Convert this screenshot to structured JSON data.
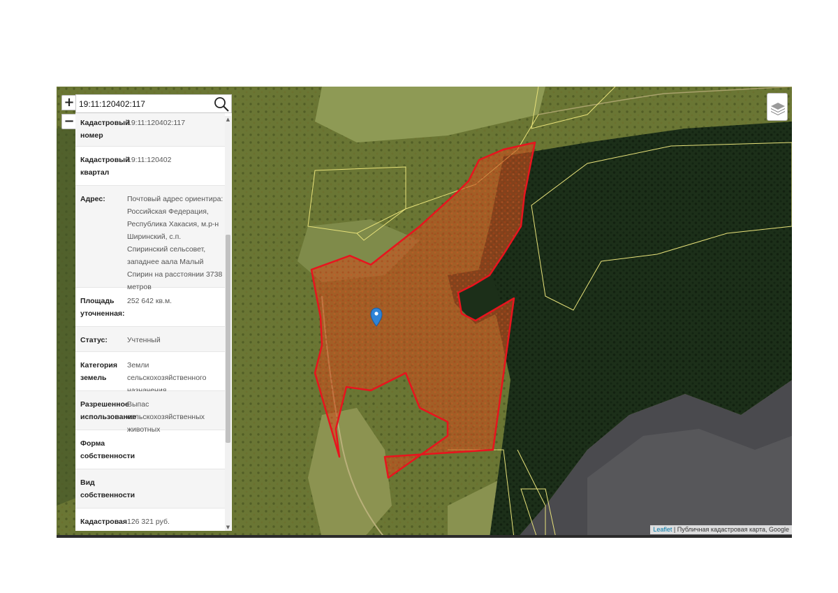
{
  "search": {
    "value": "19:11:120402:117"
  },
  "zoom": {
    "in_label": "+",
    "out_label": "−"
  },
  "info": {
    "rows": [
      {
        "label": "Кадастровый номер",
        "value": "19:11:120402:117"
      },
      {
        "label": "Кадастровый квартал",
        "value": "19:11:120402"
      },
      {
        "label": "Адрес:",
        "value": "Почтовый адрес ориентира: Российская Федерация, Республика Хакасия, м.р-н Ширинский, с.п. Спиринский сельсовет, западнее аала Малый Спирин на расстоянии 3738 метров"
      },
      {
        "label": "Площадь уточненная:",
        "value": "252 642 кв.м."
      },
      {
        "label": "Статус:",
        "value": "Учтенный"
      },
      {
        "label": "Категория земель",
        "value": "Земли сельскохозяйственного назначения"
      },
      {
        "label": "Разрешенное использование",
        "value": "Выпас сельскохозяйственных животных"
      },
      {
        "label": "Форма собственности",
        "value": ""
      },
      {
        "label": "Вид собственности",
        "value": ""
      },
      {
        "label": "Кадастровая",
        "value": "126 321 руб."
      }
    ]
  },
  "attribution": {
    "leaflet": "Leaflet",
    "separator": " | ",
    "sources": "Публичная кадастровая карта, Google"
  },
  "icons": {
    "search": "search-icon",
    "layers": "layers-icon",
    "marker": "map-marker-icon"
  },
  "colors": {
    "parcel_fill": "#c8501e",
    "parcel_stroke": "#e8141e",
    "marker": "#2f83d6",
    "boundary": "#e8e27a"
  }
}
